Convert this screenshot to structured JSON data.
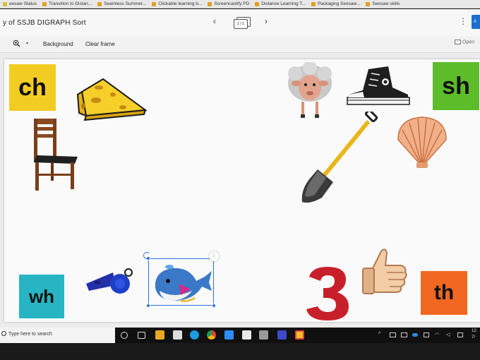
{
  "bookmarks": [
    {
      "label": "eesaw Status",
      "icon": "seesaw-icon"
    },
    {
      "label": "Transition to Distan...",
      "icon": "folder-icon"
    },
    {
      "label": "Seamless Summer...",
      "icon": "folder-icon"
    },
    {
      "label": "Clickable learning b...",
      "icon": "folder-icon"
    },
    {
      "label": "Screencastify PD",
      "icon": "folder-icon"
    },
    {
      "label": "Distance Learning T...",
      "icon": "folder-icon"
    },
    {
      "label": "Packaging Seesaw...",
      "icon": "folder-icon"
    },
    {
      "label": "Seesaw skills",
      "icon": "folder-icon"
    }
  ],
  "titlebar": {
    "doc_title": "y of SSJB DIGRAPH Sort",
    "page_indicator": "1 / 1",
    "prev_icon": "chevron-left-icon",
    "next_icon": "chevron-right-icon",
    "more_icon": "vertical-dots-icon",
    "blue_button_label": "A"
  },
  "toolbar": {
    "zoom_icon": "zoom-in-icon",
    "background_label": "Background",
    "clear_label": "Clear frame",
    "open_label": "Open"
  },
  "cards": {
    "ch": "ch",
    "sh": "sh",
    "wh": "wh",
    "th": "th"
  },
  "pictures": [
    "cheese",
    "chair",
    "sheep",
    "shoe",
    "shovel",
    "shell",
    "whistle",
    "whale",
    "three",
    "thumb"
  ],
  "colors": {
    "ch_card": "#f2cc22",
    "sh_card": "#5cbc2a",
    "wh_card": "#27b5c4",
    "th_card": "#f26722",
    "selection": "#2d6ee0"
  },
  "taskbar": {
    "search_placeholder": "Type here to search",
    "tray_time": "12:",
    "tray_date": "7/"
  }
}
